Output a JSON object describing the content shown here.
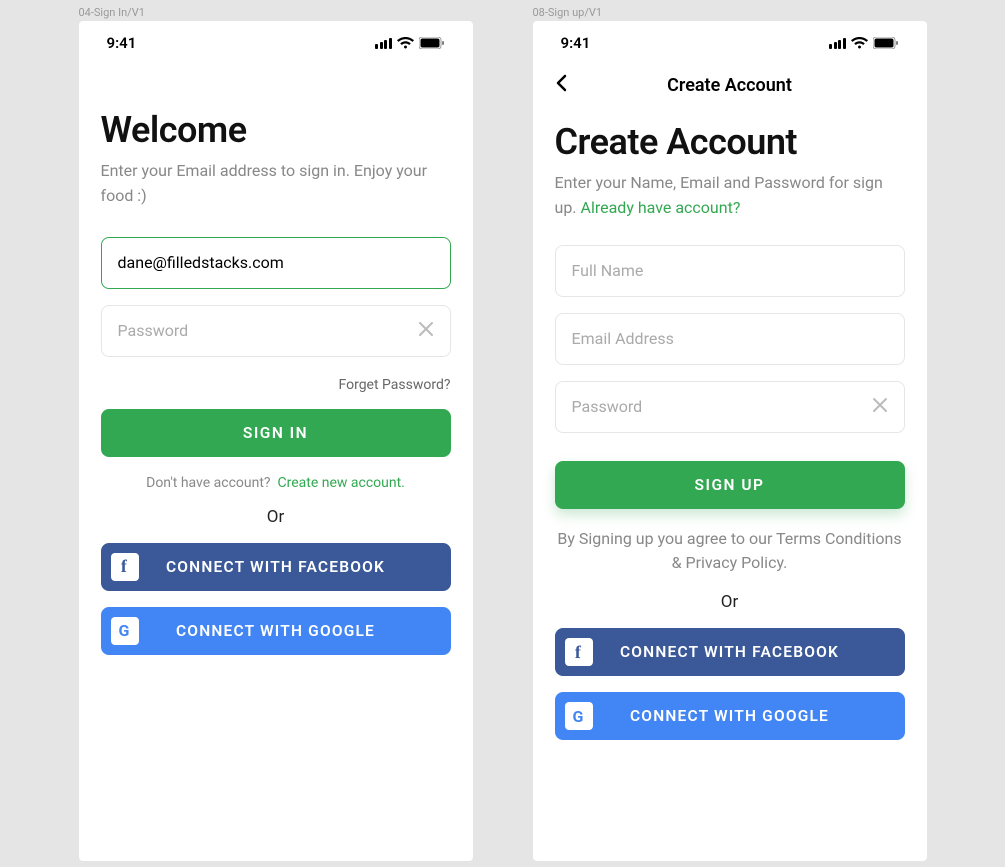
{
  "statusbar": {
    "time": "9:41"
  },
  "signin": {
    "frame_label": "04-Sign In/V1",
    "title": "Welcome",
    "subtitle": "Enter your Email address to sign in. Enjoy your food :)",
    "email_value": "dane@filledstacks.com",
    "password_placeholder": "Password",
    "forgot": "Forget Password?",
    "button": "SIGN IN",
    "prompt": "Don't have account?",
    "prompt_link": "Create new account.",
    "or": "Or",
    "facebook": "CONNECT WITH FACEBOOK",
    "google": "CONNECT WITH GOOGLE"
  },
  "signup": {
    "frame_label": "08-Sign up/V1",
    "nav_title": "Create Account",
    "title": "Create Account",
    "subtitle_a": "Enter your Name, Email and Password for sign up.",
    "subtitle_link": "Already have account?",
    "name_placeholder": "Full Name",
    "email_placeholder": "Email Address",
    "password_placeholder": "Password",
    "button": "SIGN UP",
    "terms": "By Signing up you agree to our Terms Conditions & Privacy Policy.",
    "or": "Or",
    "facebook": "CONNECT WITH FACEBOOK",
    "google": "CONNECT WITH GOOGLE"
  }
}
